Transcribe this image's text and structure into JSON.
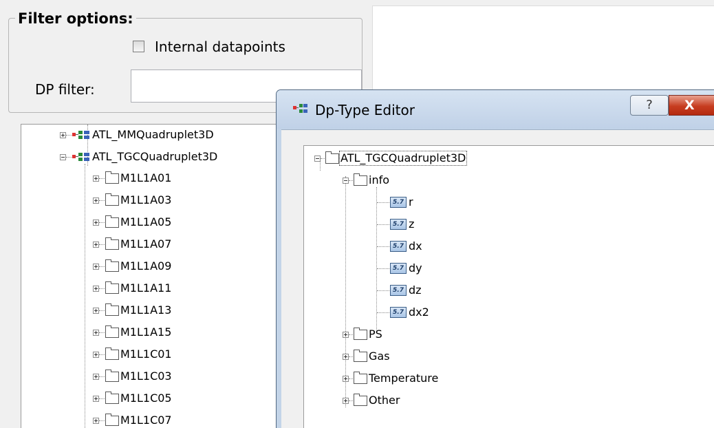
{
  "filter": {
    "group_title": "Filter options:",
    "internal_label": "Internal datapoints",
    "internal_checked": false,
    "dp_filter_label": "DP filter:",
    "dp_filter_value": ""
  },
  "left_tree": {
    "types": [
      "ATL_MMQuadruplet3D",
      "ATL_TGCQuadruplet3D"
    ],
    "children": [
      "M1L1A01",
      "M1L1A03",
      "M1L1A05",
      "M1L1A07",
      "M1L1A09",
      "M1L1A11",
      "M1L1A13",
      "M1L1A15",
      "M1L1C01",
      "M1L1C03",
      "M1L1C05",
      "M1L1C07"
    ]
  },
  "dialog": {
    "title": "Dp-Type Editor",
    "help_label": "?",
    "close_label": "X",
    "tree": {
      "root": "ATL_TGCQuadruplet3D",
      "info_label": "info",
      "info_badge": "5.7",
      "info_children": [
        "r",
        "z",
        "dx",
        "dy",
        "dz",
        "dx2"
      ],
      "collapsed_folders": [
        "PS",
        "Gas",
        "Temperature",
        "Other"
      ]
    }
  },
  "colors": {
    "window_bg": "#f0f0f0",
    "titlebar": "#c8d8ec",
    "close_red": "#c73d20"
  }
}
